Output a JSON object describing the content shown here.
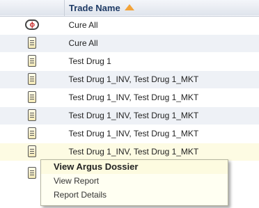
{
  "grid": {
    "header": {
      "trade_name_label": "Trade Name"
    },
    "rows": [
      {
        "icon": "pill-icon",
        "pill_glyph": "ϕ",
        "trade_name": "Cure All"
      },
      {
        "icon": "document-icon",
        "trade_name": "Cure All"
      },
      {
        "icon": "document-icon",
        "trade_name": "Test Drug 1"
      },
      {
        "icon": "document-icon",
        "trade_name": "Test Drug 1_INV, Test Drug 1_MKT"
      },
      {
        "icon": "document-icon",
        "trade_name": "Test Drug 1_INV, Test Drug 1_MKT"
      },
      {
        "icon": "document-icon",
        "trade_name": "Test Drug 1_INV, Test Drug 1_MKT"
      },
      {
        "icon": "document-icon",
        "trade_name": "Test Drug 1_INV, Test Drug 1_MKT"
      },
      {
        "icon": "document-icon",
        "trade_name": "Test Drug 1_INV, Test Drug 1_MKT"
      }
    ]
  },
  "context_menu": {
    "items": [
      {
        "label": "View Argus Dossier"
      },
      {
        "label": "View Report"
      },
      {
        "label": "Report Details"
      }
    ]
  },
  "colors": {
    "header_text": "#1f3b66",
    "sort_arrow": "#f2a33a",
    "alt_row": "#eef1f6",
    "selected_row": "#fdfbe3",
    "menu_bg": "#fffff2"
  }
}
